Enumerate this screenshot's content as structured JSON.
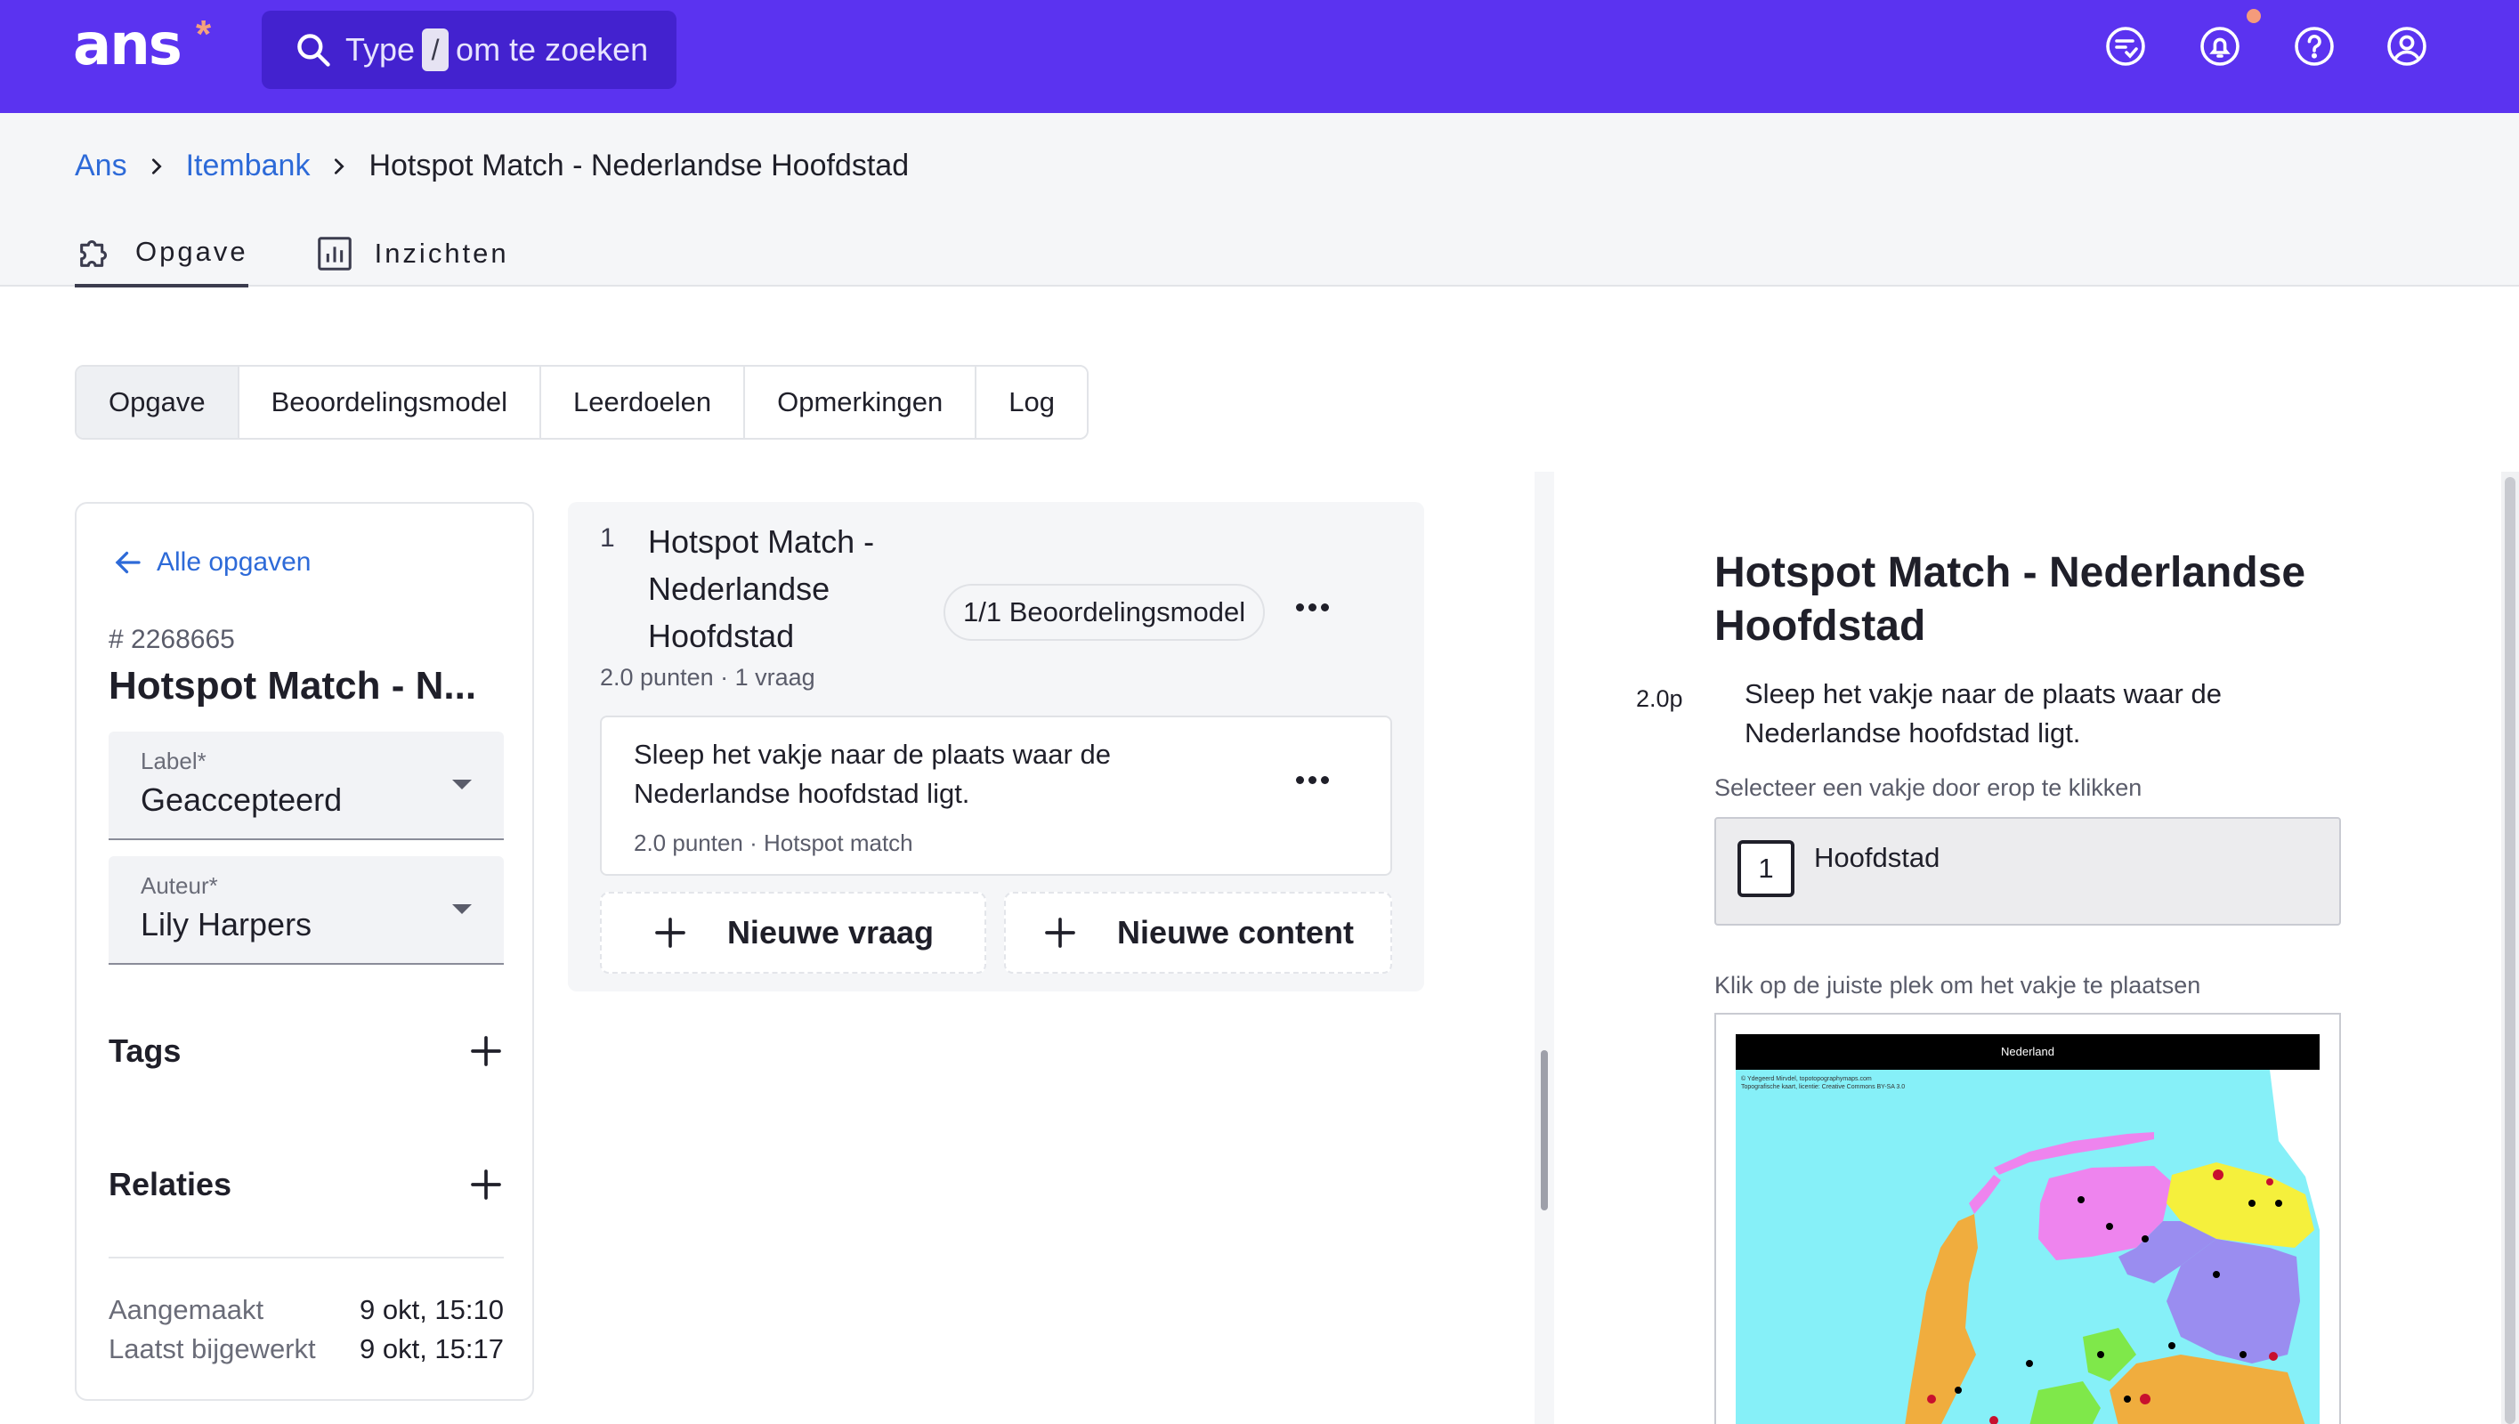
{
  "app": {
    "logo_text": "ans",
    "logo_mark": "*",
    "search": {
      "prefix": "Type",
      "key": "/",
      "suffix": "om te zoeken"
    },
    "top_icons": [
      "chat-check-icon",
      "bell-icon",
      "help-icon",
      "account-icon"
    ]
  },
  "breadcrumb": {
    "items": [
      "Ans",
      "Itembank"
    ],
    "current": "Hotspot Match - Nederlandse Hoofdstad"
  },
  "main_tabs": [
    {
      "label": "Opgave",
      "icon": "puzzle-icon",
      "active": true
    },
    {
      "label": "Inzichten",
      "icon": "chart-icon",
      "active": false
    }
  ],
  "sub_tabs": [
    {
      "label": "Opgave",
      "active": true
    },
    {
      "label": "Beoordelingsmodel",
      "active": false
    },
    {
      "label": "Leerdoelen",
      "active": false
    },
    {
      "label": "Opmerkingen",
      "active": false
    },
    {
      "label": "Log",
      "active": false
    }
  ],
  "left_panel": {
    "back_label": "Alle opgaven",
    "item_id": "# 2268665",
    "item_title": "Hotspot Match - N...",
    "label_field": {
      "label": "Label*",
      "value": "Geaccepteerd"
    },
    "author_field": {
      "label": "Auteur*",
      "value": "Lily Harpers"
    },
    "tags_title": "Tags",
    "relations_title": "Relaties",
    "created_label": "Aangemaakt",
    "created_value": "9 okt, 15:10",
    "updated_label": "Laatst bijgewerkt",
    "updated_value": "9 okt, 15:17"
  },
  "question_panel": {
    "number": "1",
    "title": "Hotspot Match - Nederlandse Hoofdstad",
    "badge": "1/1 Beoordelingsmodel",
    "meta": "2.0 punten · 1 vraag",
    "card_text": "Sleep het vakje naar de plaats waar de Nederlandse hoofdstad ligt.",
    "card_meta": "2.0 punten · Hotspot match",
    "new_question": "Nieuwe vraag",
    "new_content": "Nieuwe content"
  },
  "preview": {
    "title": "Hotspot Match - Nederlandse Hoofdstad",
    "points": "2.0p",
    "question": "Sleep het vakje naar de plaats waar de Nederlandse hoofdstad ligt.",
    "select_hint": "Selecteer een vakje door erop te klikken",
    "chip_number": "1",
    "chip_label": "Hoofdstad",
    "place_hint": "Klik op de juiste plek om het vakje te plaatsen",
    "map_title": "Nederland",
    "map_credit_1": "© Ydegeerd Mirvdel, topotopographymaps.com",
    "map_credit_2": "Topografische kaart, licentie: Creative Commons BY-SA 3.0"
  },
  "colors": {
    "brand": "#5b33f0",
    "link": "#2d6ad8",
    "accent": "#f59b7b"
  }
}
